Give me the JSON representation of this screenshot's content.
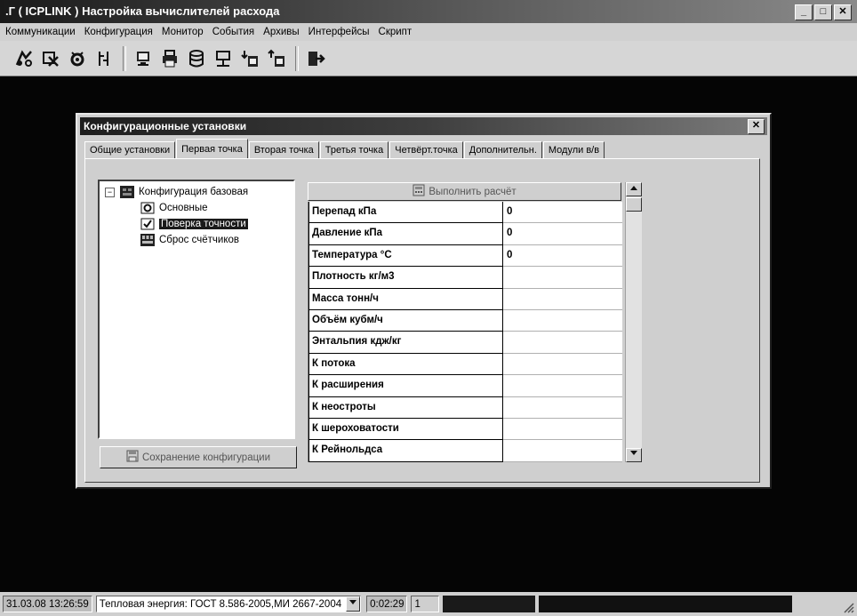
{
  "app": {
    "title": ".Г ( ICPLINK ) Настройка вычислителей расхода",
    "window_buttons": [
      "_",
      "□",
      "✕"
    ]
  },
  "menu": {
    "items": [
      "Коммуникации",
      "Конфигурация",
      "Монитор",
      "События",
      "Архивы",
      "Интерфейсы",
      "Скрипт"
    ]
  },
  "toolbar": {
    "icons": [
      "connect-icon",
      "disconnect-icon",
      "settings-icon",
      "switch-icon",
      "monitor-icon",
      "printer-icon",
      "archive-icon",
      "network-icon",
      "download-icon",
      "upload-icon",
      "exit-icon"
    ]
  },
  "dialog": {
    "title": "Конфигурационные установки",
    "close": "✕",
    "tabs": [
      "Общие установки",
      "Первая точка",
      "Вторая точка",
      "Третья точка",
      "Четвёрт.точка",
      "Дополнительн.",
      "Модули в/в"
    ],
    "active_tab_index": 1,
    "tree": {
      "root": "Конфигурация базовая",
      "root_toggle": "−",
      "items": [
        "Основные",
        "Поверка точности",
        "Сброс счётчиков"
      ],
      "selected_index": 1
    },
    "calc_button": "Выполнить расчёт",
    "save_button": "Сохранение конфигурации",
    "grid": {
      "rows": [
        {
          "name": "Перепад   кПа",
          "value": "0"
        },
        {
          "name": "Давление   кПа",
          "value": "0"
        },
        {
          "name": "Температура   °С",
          "value": "0"
        },
        {
          "name": "Плотность   кг/м3",
          "value": ""
        },
        {
          "name": "Масса   тонн/ч",
          "value": ""
        },
        {
          "name": "Объём   кубм/ч",
          "value": ""
        },
        {
          "name": "Энтальпия   кдж/кг",
          "value": ""
        },
        {
          "name": "К потока",
          "value": ""
        },
        {
          "name": "К расширения",
          "value": ""
        },
        {
          "name": "К неостроты",
          "value": ""
        },
        {
          "name": "К шероховатости",
          "value": ""
        },
        {
          "name": "К Рейнольдса",
          "value": ""
        }
      ]
    }
  },
  "statusbar": {
    "datetime": "31.03.08 13:26:59",
    "standard": "Тепловая энергия: ГОСТ 8.586-2005,МИ 2667-2004",
    "timer": "0:02:29",
    "counter": "1"
  }
}
